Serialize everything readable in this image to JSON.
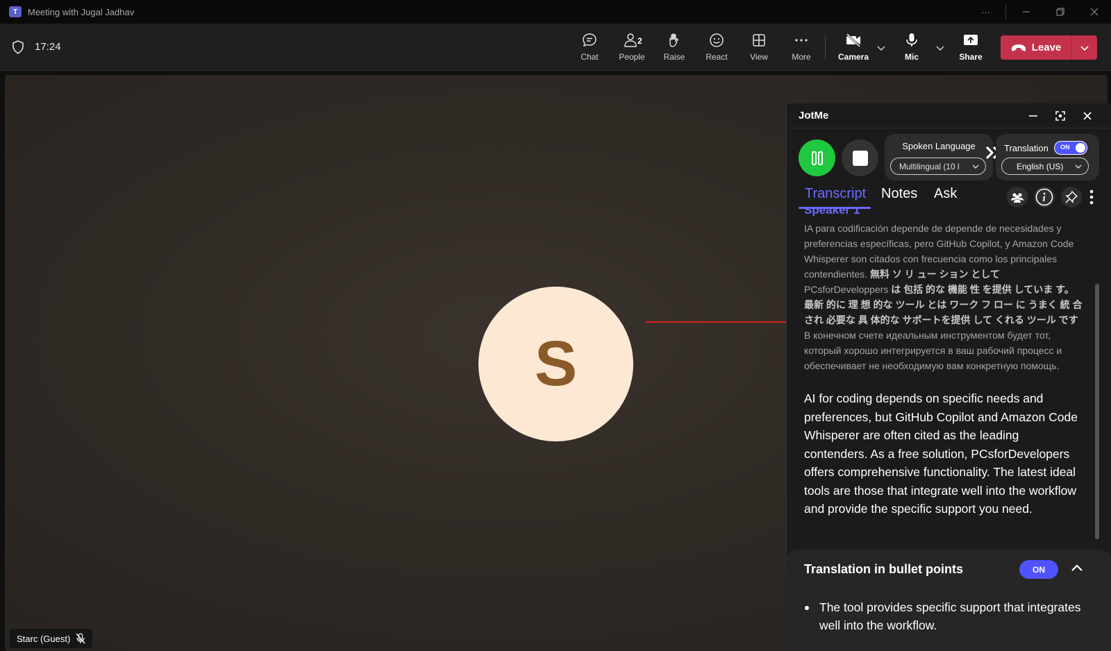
{
  "window": {
    "title": "Meeting with Jugal Jadhav",
    "app_icon": "teams-icon"
  },
  "meeting": {
    "time": "17:24"
  },
  "toolbar": {
    "chat": "Chat",
    "people": "People",
    "people_count": "2",
    "raise": "Raise",
    "react": "React",
    "view": "View",
    "more": "More",
    "camera": "Camera",
    "mic": "Mic",
    "share": "Share",
    "leave": "Leave"
  },
  "stage": {
    "avatar_letter": "S",
    "participant_name": "Starc (Guest)",
    "avatar_color": "#fde8d4"
  },
  "jotme": {
    "title": "JotMe",
    "spoken_language_label": "Spoken Language",
    "spoken_language_value": "Multilingual (10 l",
    "translation_label": "Translation",
    "translation_toggle": "ON",
    "translation_language": "English (US)",
    "tabs": [
      "Transcript",
      "Notes",
      "Ask"
    ],
    "active_tab": "Transcript",
    "speaker": "Speaker 1",
    "original_text_es": "IA para codificación depende de depende de necesidades y preferencias específicas, pero GitHub Copilot, y Amazon Code Whisperer son citados con frecuencia como los principales contendientes.",
    "original_text_ja_1": "無料 ソ リ ュー ション として",
    "original_text_ja_2": "PCsforDeveloppers",
    "original_text_ja_3": "は 包括 的な 機能 性 を提供 していま す。 最新 的に 理 想 的な ツール とは ワーク フ ロー に うまく 統 合 され 必要な 具 体的な サポートを提供 して くれる ツール です",
    "original_text_ru": "В конечном счете идеальным инструментом будет тот, который хорошо интегрируется в ваш рабочий процесс и обеспечивает не необходимую вам конкретную помощь.",
    "translated_text": "AI for coding depends on specific needs and preferences, but GitHub Copilot and Amazon Code Whisperer are often cited as the leading contenders. As a free solution, PCsforDevelopers offers comprehensive functionality. The latest ideal tools are those that integrate well into the workflow and provide the specific support you need.",
    "bullets_title": "Translation in bullet points",
    "bullets_toggle": "ON",
    "bullet_items": [
      "The tool provides specific support that integrates well into the workflow."
    ],
    "accent_color": "#6b6bff",
    "record_color": "#20c840"
  },
  "colors": {
    "leave": "#c4314b",
    "toggle_on": "#4f52ff",
    "arrow": "#e02020"
  }
}
